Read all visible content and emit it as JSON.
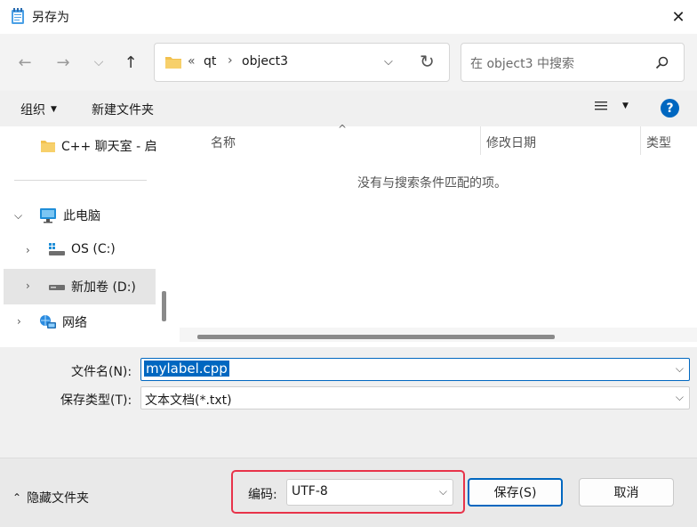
{
  "window": {
    "title": "另存为",
    "close_glyph": "✕"
  },
  "nav": {
    "back_glyph": "←",
    "forward_glyph": "→",
    "recent_glyph": "⌵",
    "up_glyph": "↑",
    "path_prefix": "«",
    "breadcrumb": [
      "qt",
      "object3"
    ],
    "separator": "›",
    "refresh_glyph": "↻",
    "search_placeholder": "在 object3 中搜索"
  },
  "toolbar": {
    "organize_label": "组织",
    "new_folder_label": "新建文件夹",
    "help_glyph": "?"
  },
  "tree": {
    "items": [
      {
        "label": "C++ 聊天室 - 启",
        "icon": "folder-icon"
      },
      {
        "label": "此电脑",
        "icon": "computer-icon",
        "expanded": true
      },
      {
        "label": "OS (C:)",
        "icon": "drive-icon"
      },
      {
        "label": "新加卷 (D:)",
        "icon": "drive-icon",
        "selected": true
      },
      {
        "label": "网络",
        "icon": "network-icon"
      }
    ]
  },
  "list": {
    "columns": [
      "名称",
      "修改日期",
      "类型"
    ],
    "empty_message": "没有与搜索条件匹配的项。"
  },
  "form": {
    "filename_label": "文件名(N):",
    "filename_value": "mylabel.cpp",
    "filetype_label": "保存类型(T):",
    "filetype_value": "文本文档(*.txt)"
  },
  "footer": {
    "hide_folders_label": "隐藏文件夹",
    "encoding_label": "编码:",
    "encoding_value": "UTF-8",
    "save_label": "保存(S)",
    "cancel_label": "取消"
  },
  "colors": {
    "accent": "#0067c0",
    "highlight_box": "#e8334a",
    "selected_row": "#e5e5e5",
    "folder": "#f2c14e"
  }
}
